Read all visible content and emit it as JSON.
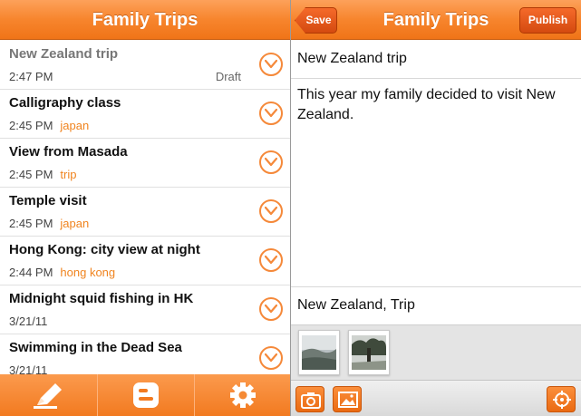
{
  "list_pane": {
    "title": "Family Trips",
    "posts": [
      {
        "title": "New Zealand trip",
        "time": "2:47 PM",
        "tag": "",
        "status": "Draft"
      },
      {
        "title": "Calligraphy class",
        "time": "2:45 PM",
        "tag": "japan",
        "status": ""
      },
      {
        "title": "View from Masada",
        "time": "2:45 PM",
        "tag": "trip",
        "status": ""
      },
      {
        "title": "Temple visit",
        "time": "2:45 PM",
        "tag": "japan",
        "status": ""
      },
      {
        "title": "Hong Kong: city view at night",
        "time": "2:44 PM",
        "tag": "hong kong",
        "status": ""
      },
      {
        "title": "Midnight squid fishing in HK",
        "time": "3/21/11",
        "tag": "",
        "status": ""
      },
      {
        "title": "Swimming in the Dead Sea",
        "time": "3/21/11",
        "tag": "",
        "status": ""
      }
    ],
    "tabs": [
      {
        "icon": "pencil-icon"
      },
      {
        "icon": "blogger-icon"
      },
      {
        "icon": "gear-icon"
      }
    ]
  },
  "editor_pane": {
    "title": "Family Trips",
    "save_label": "Save",
    "publish_label": "Publish",
    "post_title": "New Zealand trip",
    "post_body": "This year my family decided to visit New Zealand.",
    "post_labels": "New Zealand, Trip",
    "attachments": [
      "photo-thumbnail",
      "photo-thumbnail"
    ],
    "toolbar_icons": [
      "camera-icon",
      "image-icon",
      "location-icon"
    ]
  },
  "colors": {
    "accent": "#f7852d",
    "tag_text": "#f0841f"
  }
}
